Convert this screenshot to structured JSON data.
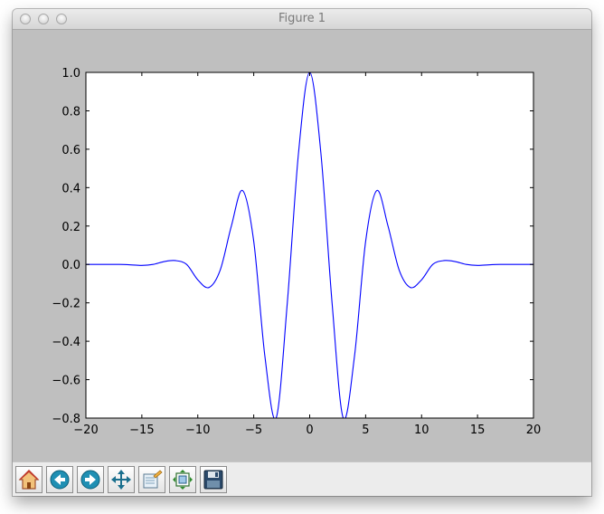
{
  "window": {
    "title": "Figure 1"
  },
  "toolbar": {
    "buttons": [
      {
        "name": "home-button",
        "icon": "home-icon"
      },
      {
        "name": "back-button",
        "icon": "back-arrow-icon"
      },
      {
        "name": "forward-button",
        "icon": "forward-arrow-icon"
      },
      {
        "name": "pan-button",
        "icon": "move-arrows-icon"
      },
      {
        "name": "zoom-button",
        "icon": "zoom-rect-icon"
      },
      {
        "name": "subplots-button",
        "icon": "subplots-icon"
      },
      {
        "name": "save-button",
        "icon": "floppy-disk-icon"
      }
    ]
  },
  "chart_data": {
    "type": "line",
    "title": "",
    "xlabel": "",
    "ylabel": "",
    "xlim": [
      -20,
      20
    ],
    "ylim": [
      -0.8,
      1.0
    ],
    "xticks": [
      -20,
      -15,
      -10,
      -5,
      0,
      5,
      10,
      15,
      20
    ],
    "xtick_labels": [
      "−20",
      "−15",
      "−10",
      "−5",
      "0",
      "5",
      "10",
      "15",
      "20"
    ],
    "yticks": [
      -0.8,
      -0.6,
      -0.4,
      -0.2,
      0.0,
      0.2,
      0.4,
      0.6,
      0.8,
      1.0
    ],
    "ytick_labels": [
      "−0.8",
      "−0.6",
      "−0.4",
      "−0.2",
      "0.0",
      "0.2",
      "0.4",
      "0.6",
      "0.8",
      "1.0"
    ],
    "grid": false,
    "series": [
      {
        "color": "#0000ff",
        "x": [
          -20,
          -19,
          -18,
          -17,
          -16,
          -15,
          -14,
          -13,
          -12,
          -11,
          -10,
          -9,
          -8,
          -7,
          -6,
          -5,
          -4,
          -3,
          -2,
          -1,
          0,
          1,
          2,
          3,
          4,
          5,
          6,
          7,
          8,
          9,
          10,
          11,
          12,
          13,
          14,
          15,
          16,
          17,
          18,
          19,
          20
        ],
        "y": [
          0.0,
          0.0,
          0.0,
          0.0,
          -0.002,
          -0.005,
          0.0,
          0.015,
          0.02,
          0.0,
          -0.08,
          -0.12,
          -0.03,
          0.2,
          0.385,
          0.12,
          -0.48,
          -0.8,
          -0.2,
          0.58,
          1.0,
          0.58,
          -0.2,
          -0.8,
          -0.48,
          0.12,
          0.385,
          0.2,
          -0.03,
          -0.12,
          -0.08,
          0.0,
          0.02,
          0.015,
          0.0,
          -0.005,
          -0.002,
          0.0,
          0.0,
          0.0,
          0.0
        ]
      }
    ]
  }
}
